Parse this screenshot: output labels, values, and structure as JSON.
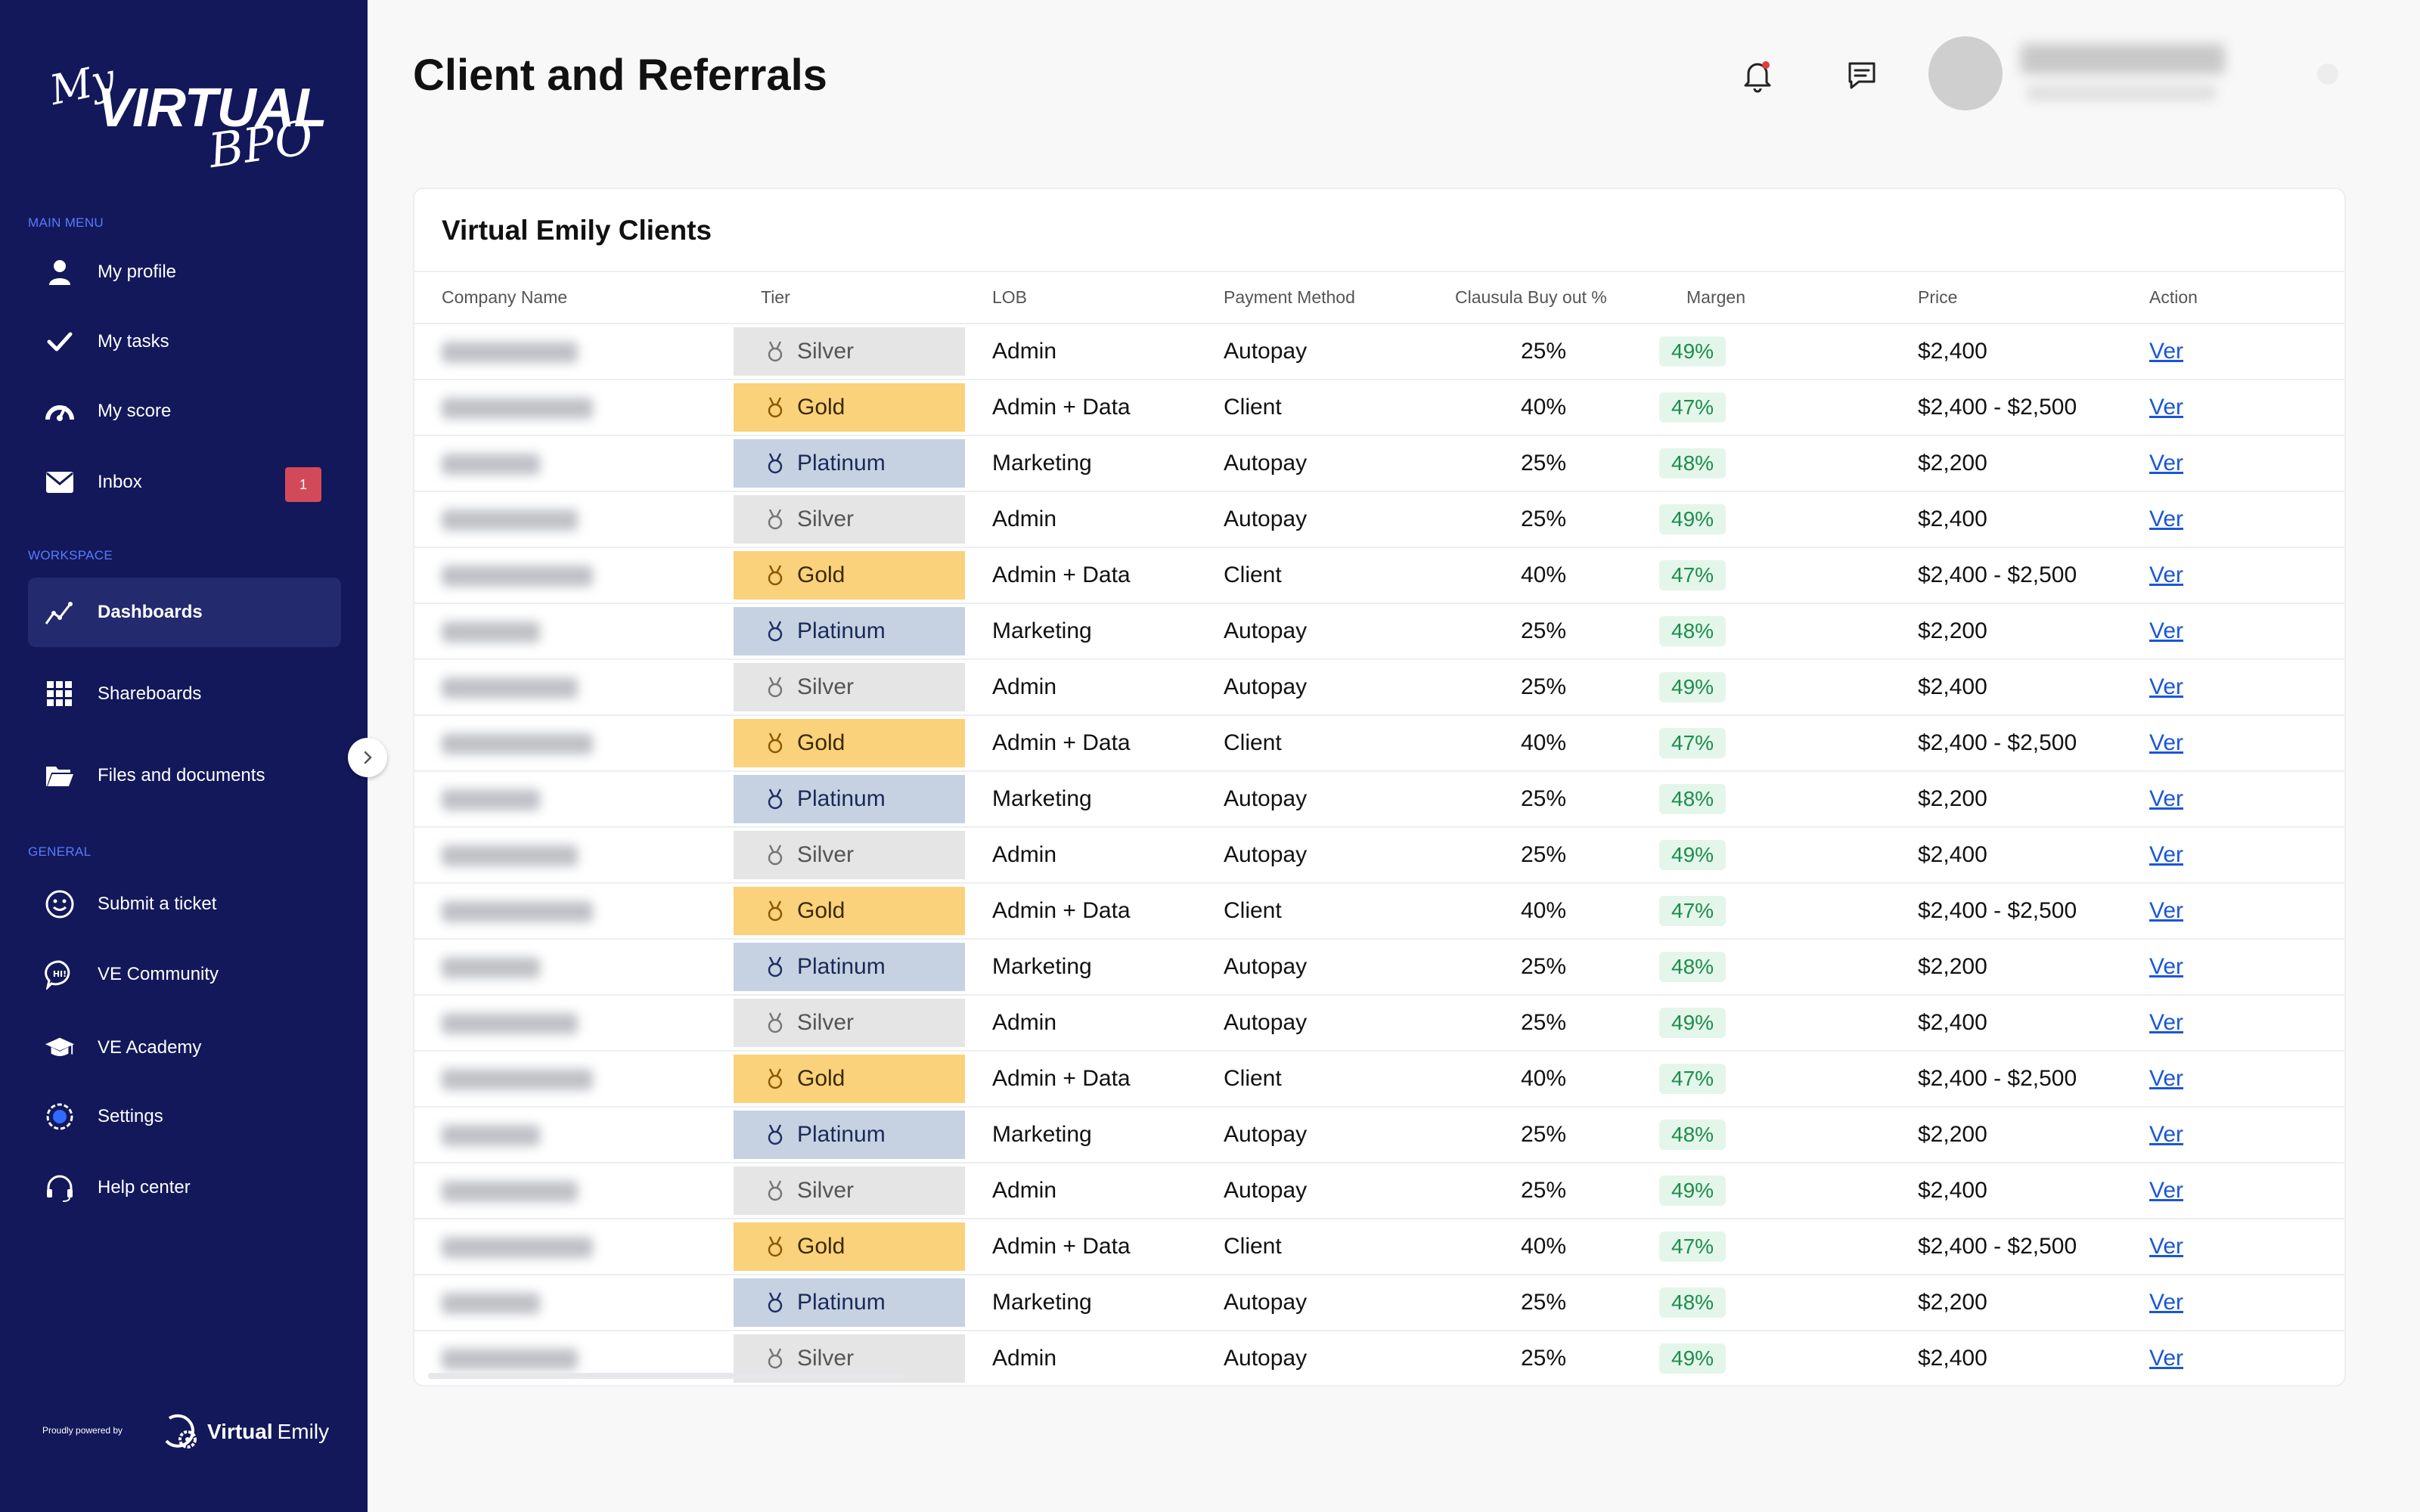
{
  "sidebar": {
    "logo": {
      "my": "My",
      "virtual": "VIRTUAL",
      "bpo": "BPO"
    },
    "sections": {
      "main": "MAIN MENU",
      "workspace": "WORKSPACE",
      "general": "GENERAL"
    },
    "items": [
      {
        "label": "My profile",
        "icon": "user-icon"
      },
      {
        "label": "My tasks",
        "icon": "check-icon"
      },
      {
        "label": "My score",
        "icon": "gauge-icon"
      },
      {
        "label": "Inbox",
        "icon": "mail-icon",
        "badge": "1"
      },
      {
        "label": "Dashboards",
        "icon": "chart-line-icon",
        "active": true
      },
      {
        "label": "Shareboards",
        "icon": "grid-icon"
      },
      {
        "label": "Files and documents",
        "icon": "folder-icon"
      },
      {
        "label": "Submit a ticket",
        "icon": "smile-icon"
      },
      {
        "label": "VE Community",
        "icon": "chat-bubble-icon"
      },
      {
        "label": "VE Academy",
        "icon": "graduation-cap-icon"
      },
      {
        "label": "Settings",
        "icon": "settings-icon"
      },
      {
        "label": "Help center",
        "icon": "headset-icon"
      }
    ],
    "powered_by": "Proudly powered by",
    "brand": {
      "bold": "Virtual",
      "light": "Emily"
    }
  },
  "header": {
    "title": "Client and Referrals"
  },
  "card": {
    "title": "Virtual Emily Clients",
    "columns": [
      "Company Name",
      "Tier",
      "LOB",
      "Payment Method",
      "Clausula Buy out %",
      "Margen",
      "Price",
      "Action"
    ],
    "tier_colors": {
      "Silver": "#e5e5e5",
      "Gold": "#fad27c",
      "Platinum": "#c6d2e1"
    },
    "rows": [
      {
        "tier": "Silver",
        "lob": "Admin",
        "payment": "Autopay",
        "buyout": "25%",
        "margen": "49%",
        "price": "$2,400",
        "action": "Ver"
      },
      {
        "tier": "Gold",
        "lob": "Admin + Data",
        "payment": "Client",
        "buyout": "40%",
        "margen": "47%",
        "price": "$2,400 - $2,500",
        "action": "Ver"
      },
      {
        "tier": "Platinum",
        "lob": "Marketing",
        "payment": "Autopay",
        "buyout": "25%",
        "margen": "48%",
        "price": "$2,200",
        "action": "Ver"
      },
      {
        "tier": "Silver",
        "lob": "Admin",
        "payment": "Autopay",
        "buyout": "25%",
        "margen": "49%",
        "price": "$2,400",
        "action": "Ver"
      },
      {
        "tier": "Gold",
        "lob": "Admin + Data",
        "payment": "Client",
        "buyout": "40%",
        "margen": "47%",
        "price": "$2,400 - $2,500",
        "action": "Ver"
      },
      {
        "tier": "Platinum",
        "lob": "Marketing",
        "payment": "Autopay",
        "buyout": "25%",
        "margen": "48%",
        "price": "$2,200",
        "action": "Ver"
      },
      {
        "tier": "Silver",
        "lob": "Admin",
        "payment": "Autopay",
        "buyout": "25%",
        "margen": "49%",
        "price": "$2,400",
        "action": "Ver"
      },
      {
        "tier": "Gold",
        "lob": "Admin + Data",
        "payment": "Client",
        "buyout": "40%",
        "margen": "47%",
        "price": "$2,400 - $2,500",
        "action": "Ver"
      },
      {
        "tier": "Platinum",
        "lob": "Marketing",
        "payment": "Autopay",
        "buyout": "25%",
        "margen": "48%",
        "price": "$2,200",
        "action": "Ver"
      },
      {
        "tier": "Silver",
        "lob": "Admin",
        "payment": "Autopay",
        "buyout": "25%",
        "margen": "49%",
        "price": "$2,400",
        "action": "Ver"
      },
      {
        "tier": "Gold",
        "lob": "Admin + Data",
        "payment": "Client",
        "buyout": "40%",
        "margen": "47%",
        "price": "$2,400 - $2,500",
        "action": "Ver"
      },
      {
        "tier": "Platinum",
        "lob": "Marketing",
        "payment": "Autopay",
        "buyout": "25%",
        "margen": "48%",
        "price": "$2,200",
        "action": "Ver"
      },
      {
        "tier": "Silver",
        "lob": "Admin",
        "payment": "Autopay",
        "buyout": "25%",
        "margen": "49%",
        "price": "$2,400",
        "action": "Ver"
      },
      {
        "tier": "Gold",
        "lob": "Admin + Data",
        "payment": "Client",
        "buyout": "40%",
        "margen": "47%",
        "price": "$2,400 - $2,500",
        "action": "Ver"
      },
      {
        "tier": "Platinum",
        "lob": "Marketing",
        "payment": "Autopay",
        "buyout": "25%",
        "margen": "48%",
        "price": "$2,200",
        "action": "Ver"
      },
      {
        "tier": "Silver",
        "lob": "Admin",
        "payment": "Autopay",
        "buyout": "25%",
        "margen": "49%",
        "price": "$2,400",
        "action": "Ver"
      },
      {
        "tier": "Gold",
        "lob": "Admin + Data",
        "payment": "Client",
        "buyout": "40%",
        "margen": "47%",
        "price": "$2,400 - $2,500",
        "action": "Ver"
      },
      {
        "tier": "Platinum",
        "lob": "Marketing",
        "payment": "Autopay",
        "buyout": "25%",
        "margen": "48%",
        "price": "$2,200",
        "action": "Ver"
      },
      {
        "tier": "Silver",
        "lob": "Admin",
        "payment": "Autopay",
        "buyout": "25%",
        "margen": "49%",
        "price": "$2,400",
        "action": "Ver"
      }
    ]
  }
}
